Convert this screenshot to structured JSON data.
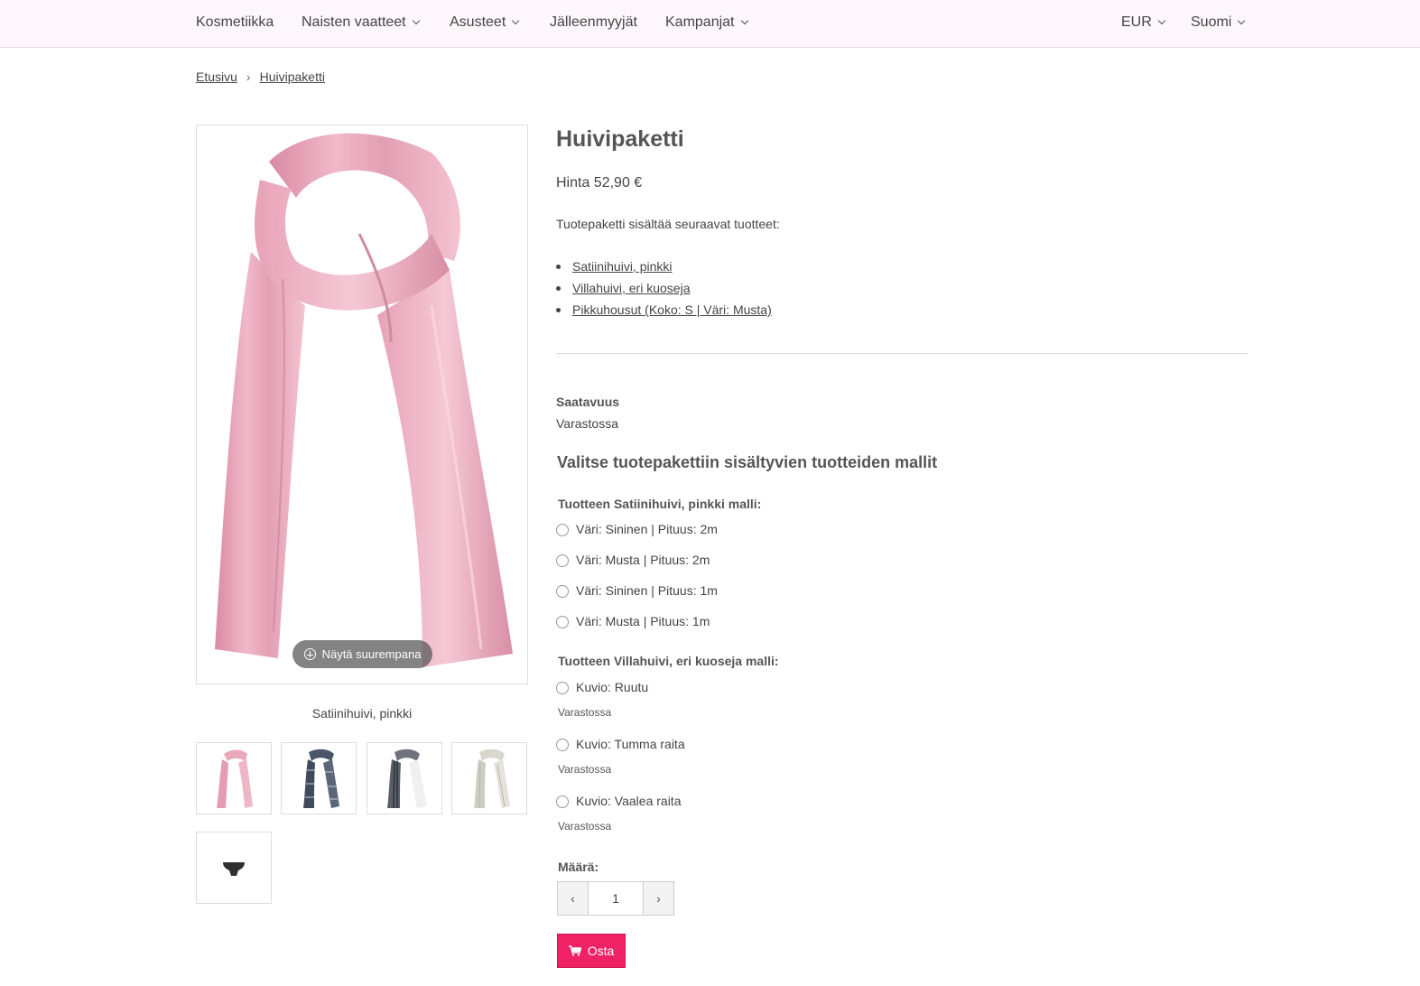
{
  "nav": {
    "items": [
      {
        "label": "Kosmetiikka",
        "dropdown": false
      },
      {
        "label": "Naisten vaatteet",
        "dropdown": true
      },
      {
        "label": "Asusteet",
        "dropdown": true
      },
      {
        "label": "Jälleenmyyjät",
        "dropdown": false
      },
      {
        "label": "Kampanjat",
        "dropdown": true
      }
    ],
    "currency": "EUR",
    "language": "Suomi"
  },
  "breadcrumb": [
    "Etusivu",
    "Huivipaketti"
  ],
  "gallery": {
    "zoom_label": "Näytä suurempana",
    "caption": "Satiinihuivi, pinkki",
    "colors": {
      "pink": "#e9a3b8",
      "pink_dark": "#d98aa3"
    }
  },
  "product": {
    "title": "Huivipaketti",
    "price": "Hinta 52,90 €",
    "intro": "Tuotepaketti sisältää seuraavat tuotteet:",
    "contents": [
      "Satiinihuivi, pinkki",
      "Villahuivi, eri kuoseja",
      "Pikkuhousut (Koko: S | Väri: Musta)"
    ],
    "availability_label": "Saatavuus",
    "availability_value": "Varastossa",
    "choose_title": "Valitse tuotepakettiin sisältyvien tuotteiden mallit",
    "groups": [
      {
        "label": "Tuotteen Satiinihuivi, pinkki malli:",
        "options": [
          "Väri: Sininen | Pituus: 2m",
          "Väri: Musta | Pituus: 2m",
          "Väri: Sininen | Pituus: 1m",
          "Väri: Musta | Pituus: 1m"
        ]
      },
      {
        "label": "Tuotteen Villahuivi, eri kuoseja malli:",
        "options": [
          {
            "label": "Kuvio: Ruutu",
            "stock": "Varastossa"
          },
          {
            "label": "Kuvio: Tumma raita",
            "stock": "Varastossa"
          },
          {
            "label": "Kuvio: Vaalea raita",
            "stock": "Varastossa"
          }
        ]
      }
    ],
    "quantity_label": "Määrä:",
    "quantity": "1",
    "buy_label": "Osta",
    "buy_color": "#ef2266"
  }
}
